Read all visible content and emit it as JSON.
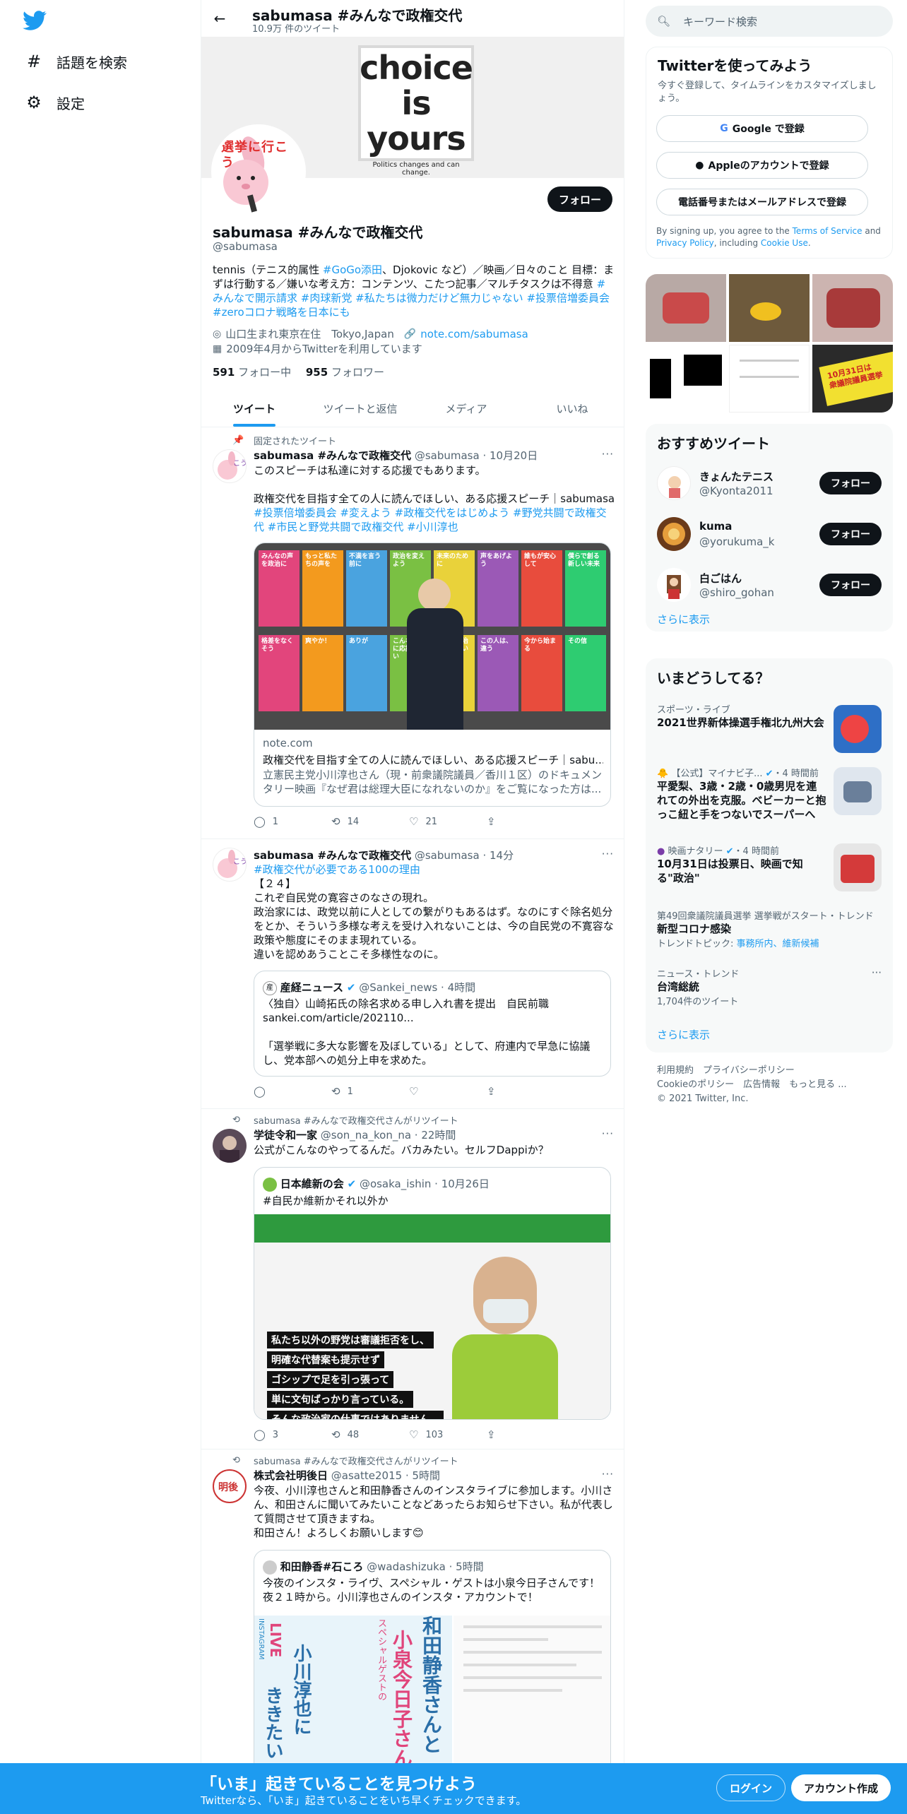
{
  "colors": {
    "accent": "#1d9bf0",
    "text": "#0f1419",
    "muted": "#536471",
    "border": "#eff3f4"
  },
  "nav": {
    "logo": "twitter-bird-icon",
    "items": [
      {
        "icon": "hashtag-icon",
        "label": "話題を検索"
      },
      {
        "icon": "gear-icon",
        "label": "設定"
      }
    ]
  },
  "header": {
    "title": "sabumasa #みんなで政権交代",
    "subtitle": "10.9万 件のツイート"
  },
  "banner": {
    "words": [
      "choice",
      "is",
      "yours"
    ],
    "caption": "Politics changes and can change."
  },
  "avatar_text": "選挙に行こう",
  "profile": {
    "follow_label": "フォロー",
    "name": "sabumasa #みんなで政権交代",
    "handle": "@sabumasa",
    "bio_plain1": "tennis（テニス的属性 ",
    "bio_tag1": "#GoGo添田",
    "bio_plain2": "、Djokovic など）／映画／日々のこと 目標：まずは行動する／嫌いな考え方：コンテンツ、こたつ記事／マルチタスクは不得意 ",
    "bio_tags2": "#みんなで開示請求 #肉球新党 #私たちは微力だけど無力じゃない #投票倍増委員会 #zeroコロナ戦略を日本にも",
    "location": "山口生まれ東京在住　Tokyo,Japan",
    "url": "note.com/sabumasa",
    "joined": "2009年4月からTwitterを利用しています",
    "following_count": "591",
    "following_label": " フォロー中",
    "followers_count": "955",
    "followers_label": " フォロワー"
  },
  "tabs": [
    "ツイート",
    "ツイートと返信",
    "メディア",
    "いいね"
  ],
  "tweets": [
    {
      "context": "固定されたツイート",
      "name": "sabumasa #みんなで政権交代",
      "handle": "@sabumasa",
      "time": "10月20日",
      "text1": "このスピーチは私達に対する応援でもあります。\n\n政権交代を目指す全ての人に読んでほしい、ある応援スピーチ｜sabumasa",
      "tags": "#投票倍増委員会 #変えよう #政権交代をはじめよう #野党共闘で政権交代 #市民と野党共闘で政権交代 #小川淳也",
      "card_domain": "note.com",
      "card_title": "政権交代を目指す全ての人に読んでほしい、ある応援スピーチ｜sabu...",
      "card_desc": "立憲民主党小川淳也さん（現・前衆議院議員／香川１区）のドキュメンタリー映画『なぜ君は総理大臣になれないのか』をご覧になった方は...",
      "card_boards": [
        "みんなの声を政治に",
        "もっと私たちの声を",
        "不満を言う前に",
        "政治を変えよう",
        "未来のために",
        "声をあげよう",
        "誰もが安心して",
        "僕らで創る新しい未来",
        "格差をなくそう",
        "爽やか！",
        "ありが",
        "こんな政治に応援したい",
        "日本の政治を変えたい",
        "この人は、違う",
        "今から始まる",
        "その信"
      ],
      "replies": "1",
      "retweets": "14",
      "likes": "21"
    },
    {
      "name": "sabumasa #みんなで政権交代",
      "handle": "@sabumasa",
      "time": "14分",
      "tag": "#政権交代が必要である100の理由",
      "text": "【２４】\nこれぞ自民党の寛容さのなさの現れ。\n政治家には、政党以前に人としての繋がりもあるはず。なのにすぐ除名処分をとか、そういう多様な考えを受け入れないことは、今の自民党の不寛容な政策や態度にそのまま現れている。\n違いを認めあうことこそ多様性なのに。",
      "quote_name": "産経ニュース",
      "quote_handle": "@Sankei_news",
      "quote_time": "4時間",
      "quote_text": "〈独自〉山崎拓氏の除名求める申し入れ書を提出　自民前職\nsankei.com/article/202110...\n\n「選挙戦に多大な影響を及ぼしている」として、府連内で早急に協議し、党本部への処分上申を求めた。",
      "replies": "",
      "retweets": "1",
      "likes": ""
    },
    {
      "context": "sabumasa #みんなで政権交代さんがリツイート",
      "name": "学徒令和一家",
      "handle": "@son_na_kon_na",
      "time": "22時間",
      "text": "公式がこんなのやってるんだ。バカみたい。セルフDappiか？",
      "quote_name": "日本維新の会",
      "quote_handle": "@osaka_ishin",
      "quote_time": "10月26日",
      "quote_text": "#自民か維新かそれ以外か",
      "poster_lines": [
        "私たち以外の野党は審議拒否をし、",
        "明確な代替案も提示せず",
        "ゴシップで足を引っ張って",
        "単に文句ばっかり言っている。",
        "そんな政治家の仕事ではありません。"
      ],
      "replies": "3",
      "retweets": "48",
      "likes": "103"
    },
    {
      "context": "sabumasa #みんなで政権交代さんがリツイート",
      "name": "株式会社明後日",
      "handle": "@asatte2015",
      "time": "5時間",
      "text": "今夜、小川淳也さんと和田静香さんのインスタライブに参加します。小川さん、和田さんに聞いてみたいことなどあったらお知らせ下さい。私が代表して質問させて頂きますね。\n和田さん！よろしくお願いします😊",
      "quote_name": "和田静香#石ころ",
      "quote_handle": "@wadashizuka",
      "quote_time": "5時間",
      "quote_text": "今夜のインスタ・ライヴ、スペシャル・ゲストは小泉今日子さんです！\n夜２１時から。小川淳也さんのインスタ・アカウントで！",
      "poster_words": [
        "INSTAGRAM",
        "LIVE",
        "小川淳也に",
        "ききたい",
        "スペシャルゲストの",
        "小泉今日子さん",
        "和田静香さんと"
      ]
    }
  ],
  "right": {
    "search_placeholder": "キーワード検索",
    "signup": {
      "title": "Twitterを使ってみよう",
      "subtitle": "今すぐ登録して、タイムラインをカスタマイズしましょう。",
      "google": "Google で登録",
      "apple": "Appleのアカウントで登録",
      "phone": "電話番号またはメールアドレスで登録",
      "terms_1": "By signing up, you agree to the ",
      "terms_link1": "Terms of Service",
      "terms_2": " and ",
      "terms_link2": "Privacy Policy",
      "terms_3": ", including ",
      "terms_link3": "Cookie Use",
      "terms_4": "."
    },
    "media_label": "10月31日は\n衆議院議員選挙",
    "recommend": {
      "title": "おすすめツイート",
      "follow_label": "フォロー",
      "users": [
        {
          "name": "きょんたテニス",
          "handle": "@Kyonta2011"
        },
        {
          "name": "kuma",
          "handle": "@yorukuma_k"
        },
        {
          "name": "白ごはん",
          "handle": "@shiro_gohan"
        }
      ],
      "more": "さらに表示"
    },
    "trends": {
      "title": "いまどうしてる？",
      "items": [
        {
          "cat": "スポーツ・ライブ",
          "title": "2021世界新体操選手権北九州大会"
        },
        {
          "cat": "【公式】マイナビ子...",
          "cat_time": "・4 時間前",
          "title": "平愛梨、3歳・2歳・0歳男児を連れての外出を克服。ベビーカーと抱っこ紐と手をつないでスーパーへ"
        },
        {
          "cat": "映画ナタリー",
          "cat_time": "・4 時間前",
          "title": "10月31日は投票日、映画で知る\"政治\""
        },
        {
          "cat": "第49回衆議院議員選挙 選挙戦がスタート・トレンド",
          "title": "新型コロナ感染",
          "sub_pre": "トレンドトピック: ",
          "sub_links": "事務所内、維新候補"
        },
        {
          "cat": "ニュース・トレンド",
          "title": "台湾総統",
          "sub": "1,704件のツイート"
        }
      ],
      "more": "さらに表示"
    },
    "footer": {
      "line1": "利用規約　プライバシーポリシー",
      "line2": "Cookieのポリシー　広告情報　もっと見る ...",
      "line3": "© 2021 Twitter, Inc."
    }
  },
  "bottom": {
    "title": "「いま」起きていることを見つけよう",
    "subtitle": "Twitterなら、「いま」起きていることをいち早くチェックできます。",
    "login": "ログイン",
    "signup": "アカウント作成"
  }
}
